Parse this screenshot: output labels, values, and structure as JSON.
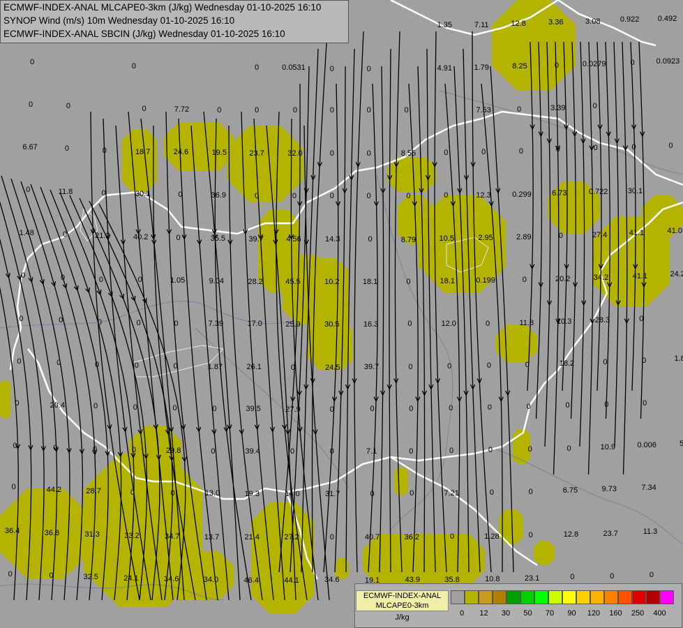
{
  "header": {
    "line1": "ECMWF-INDEX-ANAL MLCAPE0-3km (J/kg) Wednesday 01-10-2025 16:10",
    "line2": "SYNOP Wind (m/s) 10m Wednesday 01-10-2025 16:10",
    "line3": "ECMWF-INDEX-ANAL SBCIN (J/kg) Wednesday 01-10-2025 16:10"
  },
  "legend": {
    "title_line1": "ECMWF-INDEX-ANAL",
    "title_line2": "MLCAPE0-3km",
    "unit": "J/kg",
    "colors": [
      "#a0a0a0",
      "#b3b300",
      "#c89a20",
      "#b08000",
      "#00a000",
      "#00d000",
      "#00ff00",
      "#c8ff00",
      "#ffff00",
      "#ffd000",
      "#ffb000",
      "#ff8000",
      "#ff5000",
      "#e00000",
      "#b00000",
      "#ff00ff",
      "#c000ff",
      "#8000ff",
      "#4000ff",
      "#0000ff",
      "#0080ff",
      "#00c0ff",
      "#40ffff",
      "#a0ffff",
      "#ffffff"
    ],
    "ticks": [
      "0",
      "12",
      "30",
      "50",
      "70",
      "90",
      "120",
      "160",
      "250",
      "400"
    ]
  },
  "values": [
    {
      "t": "0",
      "x": 0.47,
      "y": 3.6
    },
    {
      "t": "0",
      "x": 8.5,
      "y": 3.6
    },
    {
      "t": "0",
      "x": 39.6,
      "y": 4.3
    },
    {
      "t": "0",
      "x": 48.6,
      "y": 4.3
    },
    {
      "t": "1.35",
      "x": 65.1,
      "y": 4.0
    },
    {
      "t": "7.11",
      "x": 70.5,
      "y": 4.0
    },
    {
      "t": "12.8",
      "x": 75.9,
      "y": 3.8
    },
    {
      "t": "3.36",
      "x": 81.4,
      "y": 3.6
    },
    {
      "t": "3.08",
      "x": 86.8,
      "y": 3.4
    },
    {
      "t": "0.922",
      "x": 92.2,
      "y": 3.1
    },
    {
      "t": "0.492",
      "x": 97.7,
      "y": 3.0
    },
    {
      "t": "0",
      "x": 4.7,
      "y": 9.9
    },
    {
      "t": "0",
      "x": 19.6,
      "y": 10.6
    },
    {
      "t": "0",
      "x": 37.6,
      "y": 10.8
    },
    {
      "t": "0.0531",
      "x": 43.0,
      "y": 10.8
    },
    {
      "t": "0",
      "x": 48.6,
      "y": 11.0
    },
    {
      "t": "0",
      "x": 54.0,
      "y": 11.0
    },
    {
      "t": "4.91",
      "x": 65.1,
      "y": 10.9
    },
    {
      "t": "1.79",
      "x": 70.5,
      "y": 10.8
    },
    {
      "t": "8.25",
      "x": 76.1,
      "y": 10.6
    },
    {
      "t": "0",
      "x": 81.5,
      "y": 10.4
    },
    {
      "t": "0.0279",
      "x": 87.0,
      "y": 10.2
    },
    {
      "t": "0",
      "x": 92.6,
      "y": 10.0
    },
    {
      "t": "0.0923",
      "x": 97.8,
      "y": 9.8
    },
    {
      "t": "0",
      "x": 4.5,
      "y": 16.7
    },
    {
      "t": "0",
      "x": 10.0,
      "y": 16.9
    },
    {
      "t": "0",
      "x": 21.1,
      "y": 17.3
    },
    {
      "t": "7.72",
      "x": 26.6,
      "y": 17.4
    },
    {
      "t": "0",
      "x": 32.1,
      "y": 17.5
    },
    {
      "t": "0",
      "x": 37.6,
      "y": 17.5
    },
    {
      "t": "0",
      "x": 43.2,
      "y": 17.6
    },
    {
      "t": "0",
      "x": 48.6,
      "y": 17.6
    },
    {
      "t": "0",
      "x": 54.0,
      "y": 17.6
    },
    {
      "t": "0",
      "x": 59.5,
      "y": 17.6
    },
    {
      "t": "7.53",
      "x": 70.8,
      "y": 17.6
    },
    {
      "t": "0",
      "x": 76.0,
      "y": 17.4
    },
    {
      "t": "3.39",
      "x": 81.7,
      "y": 17.2
    },
    {
      "t": "0",
      "x": 87.1,
      "y": 16.9
    },
    {
      "t": "6.67",
      "x": 4.4,
      "y": 23.4
    },
    {
      "t": "0",
      "x": 9.8,
      "y": 23.7
    },
    {
      "t": "0",
      "x": 15.3,
      "y": 24.0
    },
    {
      "t": "18.7",
      "x": 20.9,
      "y": 24.2
    },
    {
      "t": "24.6",
      "x": 26.5,
      "y": 24.2
    },
    {
      "t": "19.5",
      "x": 32.1,
      "y": 24.3
    },
    {
      "t": "23.7",
      "x": 37.6,
      "y": 24.4
    },
    {
      "t": "32.0",
      "x": 43.2,
      "y": 24.4
    },
    {
      "t": "0",
      "x": 48.6,
      "y": 24.4
    },
    {
      "t": "0",
      "x": 54.0,
      "y": 24.4
    },
    {
      "t": "8.55",
      "x": 59.8,
      "y": 24.4
    },
    {
      "t": "0",
      "x": 65.3,
      "y": 24.3
    },
    {
      "t": "0",
      "x": 70.8,
      "y": 24.2
    },
    {
      "t": "0",
      "x": 76.3,
      "y": 24.1
    },
    {
      "t": "0",
      "x": 81.7,
      "y": 23.8
    },
    {
      "t": "0",
      "x": 87.2,
      "y": 23.6
    },
    {
      "t": "0",
      "x": 92.8,
      "y": 23.4
    },
    {
      "t": "0",
      "x": 98.2,
      "y": 23.2
    },
    {
      "t": "0",
      "x": 4.1,
      "y": 30.2
    },
    {
      "t": "11.8",
      "x": 9.6,
      "y": 30.5
    },
    {
      "t": "0",
      "x": 15.2,
      "y": 30.8
    },
    {
      "t": "30.1",
      "x": 20.9,
      "y": 30.9
    },
    {
      "t": "0",
      "x": 26.4,
      "y": 31.0
    },
    {
      "t": "36.9",
      "x": 32.0,
      "y": 31.1
    },
    {
      "t": "0",
      "x": 37.6,
      "y": 31.2
    },
    {
      "t": "0",
      "x": 43.1,
      "y": 31.2
    },
    {
      "t": "0",
      "x": 48.6,
      "y": 31.2
    },
    {
      "t": "0",
      "x": 54.0,
      "y": 31.2
    },
    {
      "t": "0",
      "x": 59.8,
      "y": 31.2
    },
    {
      "t": "0",
      "x": 65.3,
      "y": 31.1
    },
    {
      "t": "12.3",
      "x": 70.8,
      "y": 31.1
    },
    {
      "t": "0.299",
      "x": 76.4,
      "y": 31.0
    },
    {
      "t": "6.73",
      "x": 81.9,
      "y": 30.8
    },
    {
      "t": "0.722",
      "x": 87.6,
      "y": 30.6
    },
    {
      "t": "30.1",
      "x": 93.0,
      "y": 30.4
    },
    {
      "t": "1.48",
      "x": 3.9,
      "y": 37.1
    },
    {
      "t": "0",
      "x": 9.5,
      "y": 37.3
    },
    {
      "t": "21.2",
      "x": 15.0,
      "y": 37.6
    },
    {
      "t": "40.2",
      "x": 20.6,
      "y": 37.8
    },
    {
      "t": "0",
      "x": 26.1,
      "y": 37.9
    },
    {
      "t": "35.5",
      "x": 31.9,
      "y": 38.0
    },
    {
      "t": "39.7",
      "x": 37.5,
      "y": 38.1
    },
    {
      "t": "4.56",
      "x": 43.0,
      "y": 38.1
    },
    {
      "t": "14.3",
      "x": 48.7,
      "y": 38.1
    },
    {
      "t": "0",
      "x": 54.2,
      "y": 38.1
    },
    {
      "t": "8.79",
      "x": 59.8,
      "y": 38.2
    },
    {
      "t": "10.5",
      "x": 65.4,
      "y": 38.0
    },
    {
      "t": "2.95",
      "x": 71.1,
      "y": 37.9
    },
    {
      "t": "2.89",
      "x": 76.7,
      "y": 37.8
    },
    {
      "t": "0",
      "x": 82.1,
      "y": 37.6
    },
    {
      "t": "27.4",
      "x": 87.8,
      "y": 37.4
    },
    {
      "t": "41.1",
      "x": 93.2,
      "y": 37.1
    },
    {
      "t": "41.0",
      "x": 98.8,
      "y": 36.8
    },
    {
      "t": "0",
      "x": 3.4,
      "y": 43.9
    },
    {
      "t": "0",
      "x": 9.2,
      "y": 44.2
    },
    {
      "t": "0",
      "x": 14.8,
      "y": 44.5
    },
    {
      "t": "0",
      "x": 20.5,
      "y": 44.6
    },
    {
      "t": "1.05",
      "x": 26.0,
      "y": 44.7
    },
    {
      "t": "9.04",
      "x": 31.7,
      "y": 44.8
    },
    {
      "t": "28.2",
      "x": 37.4,
      "y": 44.9
    },
    {
      "t": "45.5",
      "x": 42.9,
      "y": 44.9
    },
    {
      "t": "10.2",
      "x": 48.6,
      "y": 44.9
    },
    {
      "t": "18.1",
      "x": 54.2,
      "y": 44.9
    },
    {
      "t": "0",
      "x": 59.8,
      "y": 44.9
    },
    {
      "t": "18.1",
      "x": 65.5,
      "y": 44.8
    },
    {
      "t": "0.199",
      "x": 71.1,
      "y": 44.7
    },
    {
      "t": "0",
      "x": 76.8,
      "y": 44.6
    },
    {
      "t": "20.2",
      "x": 82.4,
      "y": 44.4
    },
    {
      "t": "34.2",
      "x": 88.0,
      "y": 44.2
    },
    {
      "t": "41.1",
      "x": 93.7,
      "y": 44.0
    },
    {
      "t": "24.2",
      "x": 99.2,
      "y": 43.7
    },
    {
      "t": "0",
      "x": 3.1,
      "y": 50.8
    },
    {
      "t": "0",
      "x": 8.9,
      "y": 51.0
    },
    {
      "t": "0",
      "x": 14.6,
      "y": 51.3
    },
    {
      "t": "0",
      "x": 20.3,
      "y": 51.4
    },
    {
      "t": "0",
      "x": 25.8,
      "y": 51.5
    },
    {
      "t": "7.39",
      "x": 31.6,
      "y": 51.6
    },
    {
      "t": "17.0",
      "x": 37.3,
      "y": 51.6
    },
    {
      "t": "25.9",
      "x": 42.9,
      "y": 51.7
    },
    {
      "t": "30.5",
      "x": 48.6,
      "y": 51.7
    },
    {
      "t": "16.3",
      "x": 54.3,
      "y": 51.7
    },
    {
      "t": "0",
      "x": 60.0,
      "y": 51.6
    },
    {
      "t": "12.0",
      "x": 65.7,
      "y": 51.6
    },
    {
      "t": "0",
      "x": 71.4,
      "y": 51.5
    },
    {
      "t": "11.8",
      "x": 77.1,
      "y": 51.4
    },
    {
      "t": "10.3",
      "x": 82.6,
      "y": 51.2
    },
    {
      "t": "28.3",
      "x": 88.2,
      "y": 51.0
    },
    {
      "t": "0",
      "x": 93.9,
      "y": 50.8
    },
    {
      "t": "0",
      "x": 2.8,
      "y": 57.5
    },
    {
      "t": "0",
      "x": 8.6,
      "y": 57.8
    },
    {
      "t": "0",
      "x": 14.2,
      "y": 58.1
    },
    {
      "t": "0",
      "x": 20.0,
      "y": 58.2
    },
    {
      "t": "0",
      "x": 25.7,
      "y": 58.3
    },
    {
      "t": "1.87",
      "x": 31.5,
      "y": 58.4
    },
    {
      "t": "26.1",
      "x": 37.2,
      "y": 58.4
    },
    {
      "t": "0",
      "x": 42.9,
      "y": 58.5
    },
    {
      "t": "24.5",
      "x": 48.7,
      "y": 58.5
    },
    {
      "t": "39.7",
      "x": 54.4,
      "y": 58.4
    },
    {
      "t": "0",
      "x": 60.1,
      "y": 58.4
    },
    {
      "t": "0",
      "x": 65.8,
      "y": 58.3
    },
    {
      "t": "0",
      "x": 71.6,
      "y": 58.2
    },
    {
      "t": "0",
      "x": 77.2,
      "y": 58.1
    },
    {
      "t": "18.2",
      "x": 83.0,
      "y": 57.9
    },
    {
      "t": "0",
      "x": 88.6,
      "y": 57.7
    },
    {
      "t": "0",
      "x": 94.3,
      "y": 57.4
    },
    {
      "t": "1.8",
      "x": 99.5,
      "y": 57.1
    },
    {
      "t": "0",
      "x": 2.5,
      "y": 64.2
    },
    {
      "t": "20.4",
      "x": 8.4,
      "y": 64.5
    },
    {
      "t": "0",
      "x": 14.0,
      "y": 64.7
    },
    {
      "t": "0",
      "x": 19.8,
      "y": 64.9
    },
    {
      "t": "0",
      "x": 25.6,
      "y": 65.0
    },
    {
      "t": "0",
      "x": 31.4,
      "y": 65.1
    },
    {
      "t": "39.5",
      "x": 37.1,
      "y": 65.1
    },
    {
      "t": "27.9",
      "x": 42.9,
      "y": 65.2
    },
    {
      "t": "0",
      "x": 48.6,
      "y": 65.2
    },
    {
      "t": "0",
      "x": 54.5,
      "y": 65.1
    },
    {
      "t": "0",
      "x": 60.2,
      "y": 65.1
    },
    {
      "t": "0",
      "x": 66.0,
      "y": 65.0
    },
    {
      "t": "0",
      "x": 71.7,
      "y": 64.9
    },
    {
      "t": "0",
      "x": 77.4,
      "y": 64.8
    },
    {
      "t": "0",
      "x": 83.1,
      "y": 64.6
    },
    {
      "t": "0",
      "x": 88.8,
      "y": 64.4
    },
    {
      "t": "0",
      "x": 94.4,
      "y": 64.2
    },
    {
      "t": "0",
      "x": 2.2,
      "y": 71.0
    },
    {
      "t": "0",
      "x": 8.1,
      "y": 71.3
    },
    {
      "t": "0",
      "x": 13.9,
      "y": 71.5
    },
    {
      "t": "0",
      "x": 19.6,
      "y": 71.7
    },
    {
      "t": "29.8",
      "x": 25.4,
      "y": 71.8
    },
    {
      "t": "0",
      "x": 31.2,
      "y": 71.9
    },
    {
      "t": "39.4",
      "x": 37.0,
      "y": 71.9
    },
    {
      "t": "0",
      "x": 42.8,
      "y": 71.9
    },
    {
      "t": "0",
      "x": 48.6,
      "y": 71.9
    },
    {
      "t": "7.1",
      "x": 54.4,
      "y": 71.9
    },
    {
      "t": "0",
      "x": 60.2,
      "y": 71.9
    },
    {
      "t": "0",
      "x": 66.1,
      "y": 71.8
    },
    {
      "t": "0",
      "x": 71.8,
      "y": 71.7
    },
    {
      "t": "0",
      "x": 77.6,
      "y": 71.6
    },
    {
      "t": "0",
      "x": 83.3,
      "y": 71.4
    },
    {
      "t": "10.9",
      "x": 89.0,
      "y": 71.2
    },
    {
      "t": "0.006",
      "x": 94.7,
      "y": 70.9
    },
    {
      "t": "5",
      "x": 99.8,
      "y": 70.7
    },
    {
      "t": "0",
      "x": 2.0,
      "y": 77.6
    },
    {
      "t": "44.2",
      "x": 7.9,
      "y": 78.0
    },
    {
      "t": "28.7",
      "x": 13.7,
      "y": 78.2
    },
    {
      "t": "0",
      "x": 19.4,
      "y": 78.4
    },
    {
      "t": "0",
      "x": 25.3,
      "y": 78.5
    },
    {
      "t": "13.0",
      "x": 31.1,
      "y": 78.6
    },
    {
      "t": "19.3",
      "x": 36.9,
      "y": 78.7
    },
    {
      "t": "14.0",
      "x": 42.8,
      "y": 78.7
    },
    {
      "t": "31.7",
      "x": 48.7,
      "y": 78.7
    },
    {
      "t": "0",
      "x": 54.5,
      "y": 78.7
    },
    {
      "t": "0",
      "x": 60.3,
      "y": 78.6
    },
    {
      "t": "7.21",
      "x": 66.1,
      "y": 78.5
    },
    {
      "t": "0",
      "x": 72.0,
      "y": 78.4
    },
    {
      "t": "0",
      "x": 77.7,
      "y": 78.3
    },
    {
      "t": "6.75",
      "x": 83.5,
      "y": 78.1
    },
    {
      "t": "9.73",
      "x": 89.2,
      "y": 77.9
    },
    {
      "t": "7.34",
      "x": 95.0,
      "y": 77.7
    },
    {
      "t": "36.4",
      "x": 1.8,
      "y": 84.5
    },
    {
      "t": "36.8",
      "x": 7.6,
      "y": 84.9
    },
    {
      "t": "31.3",
      "x": 13.5,
      "y": 85.1
    },
    {
      "t": "33.2",
      "x": 19.3,
      "y": 85.3
    },
    {
      "t": "34.7",
      "x": 25.2,
      "y": 85.4
    },
    {
      "t": "13.7",
      "x": 31.0,
      "y": 85.5
    },
    {
      "t": "21.4",
      "x": 36.9,
      "y": 85.6
    },
    {
      "t": "27.2",
      "x": 42.7,
      "y": 85.6
    },
    {
      "t": "0",
      "x": 48.6,
      "y": 85.6
    },
    {
      "t": "40.7",
      "x": 54.5,
      "y": 85.6
    },
    {
      "t": "36.2",
      "x": 60.3,
      "y": 85.5
    },
    {
      "t": "0",
      "x": 66.2,
      "y": 85.4
    },
    {
      "t": "1.28",
      "x": 72.0,
      "y": 85.4
    },
    {
      "t": "0",
      "x": 77.7,
      "y": 85.2
    },
    {
      "t": "12.8",
      "x": 83.6,
      "y": 85.1
    },
    {
      "t": "23.7",
      "x": 89.4,
      "y": 85.0
    },
    {
      "t": "11.3",
      "x": 95.2,
      "y": 84.7
    },
    {
      "t": "0",
      "x": 1.5,
      "y": 91.4
    },
    {
      "t": "0",
      "x": 7.5,
      "y": 91.7
    },
    {
      "t": "32.5",
      "x": 13.3,
      "y": 91.9
    },
    {
      "t": "24.1",
      "x": 19.2,
      "y": 92.1
    },
    {
      "t": "34.6",
      "x": 25.1,
      "y": 92.2
    },
    {
      "t": "34.0",
      "x": 30.9,
      "y": 92.3
    },
    {
      "t": "46.4",
      "x": 36.8,
      "y": 92.4
    },
    {
      "t": "44.1",
      "x": 42.7,
      "y": 92.4
    },
    {
      "t": "34.6",
      "x": 48.6,
      "y": 92.3
    },
    {
      "t": "19.1",
      "x": 54.5,
      "y": 92.4
    },
    {
      "t": "43.9",
      "x": 60.4,
      "y": 92.3
    },
    {
      "t": "35.8",
      "x": 66.2,
      "y": 92.3
    },
    {
      "t": "10.8",
      "x": 72.1,
      "y": 92.2
    },
    {
      "t": "23.1",
      "x": 77.9,
      "y": 92.1
    },
    {
      "t": "0",
      "x": 83.8,
      "y": 91.9
    },
    {
      "t": "0",
      "x": 89.6,
      "y": 91.8
    },
    {
      "t": "0",
      "x": 95.4,
      "y": 91.6
    }
  ],
  "blobs": [
    [
      175,
      185,
      50,
      90
    ],
    [
      235,
      175,
      100,
      70
    ],
    [
      325,
      180,
      110,
      110
    ],
    [
      370,
      300,
      60,
      120
    ],
    [
      405,
      365,
      70,
      100
    ],
    [
      440,
      370,
      60,
      160
    ],
    [
      460,
      460,
      45,
      70
    ],
    [
      555,
      225,
      70,
      50
    ],
    [
      570,
      280,
      50,
      70
    ],
    [
      600,
      280,
      125,
      140
    ],
    [
      710,
      465,
      60,
      55
    ],
    [
      785,
      260,
      75,
      75
    ],
    [
      850,
      310,
      110,
      130
    ],
    [
      920,
      280,
      59,
      60
    ],
    [
      705,
      0,
      120,
      130
    ],
    [
      745,
      0,
      40,
      25
    ],
    [
      0,
      545,
      15,
      55
    ],
    [
      185,
      610,
      75,
      80
    ],
    [
      120,
      650,
      170,
      220
    ],
    [
      0,
      700,
      130,
      130
    ],
    [
      235,
      790,
      100,
      70
    ],
    [
      360,
      720,
      90,
      160
    ],
    [
      480,
      800,
      20,
      30
    ],
    [
      520,
      765,
      175,
      75
    ],
    [
      565,
      670,
      20,
      40
    ],
    [
      715,
      730,
      35,
      50
    ],
    [
      735,
      615,
      25,
      50
    ],
    [
      765,
      775,
      30,
      35
    ]
  ]
}
